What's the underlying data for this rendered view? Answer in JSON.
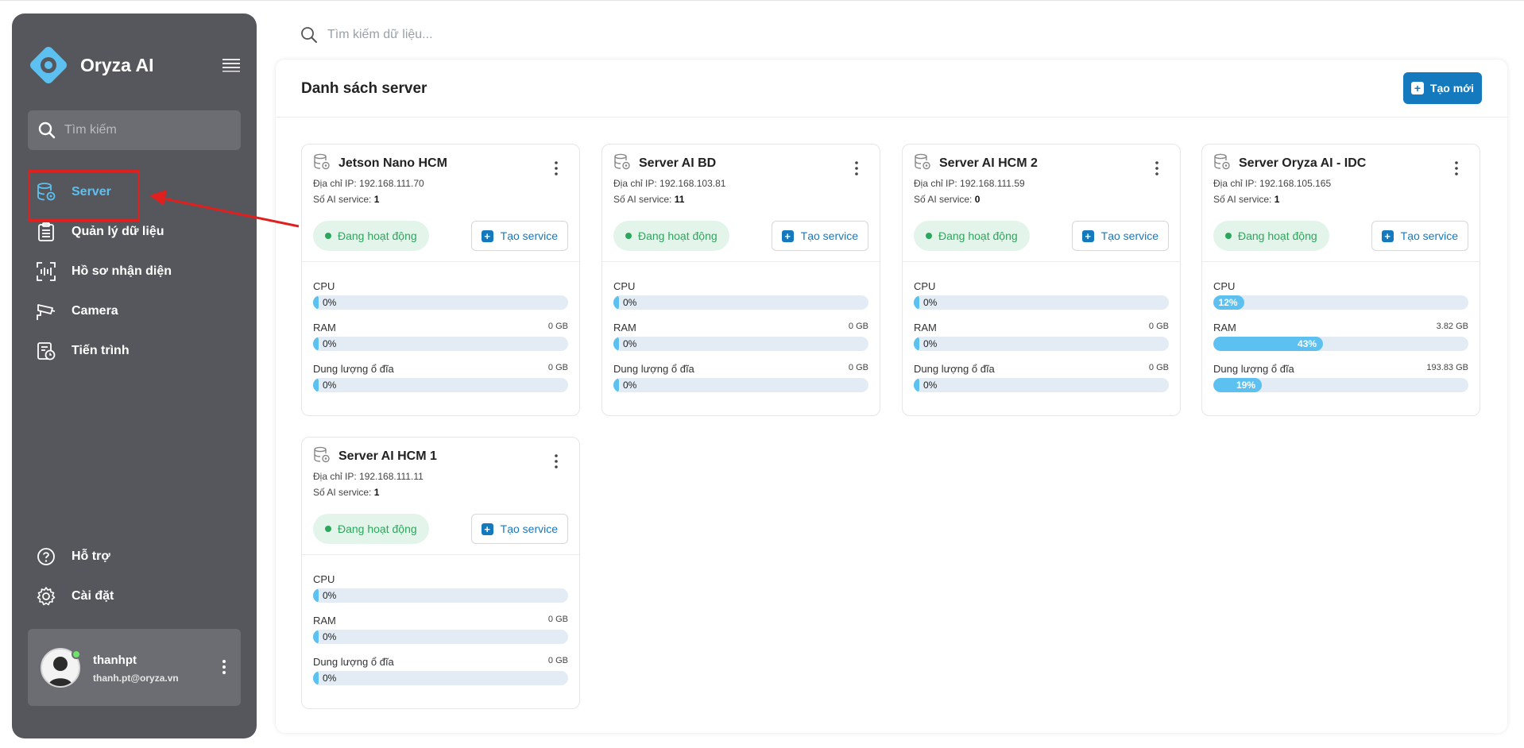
{
  "app": {
    "name": "Oryza AI"
  },
  "sidebar": {
    "search_placeholder": "Tìm kiếm",
    "items": [
      {
        "label": "Server",
        "active": true
      },
      {
        "label": "Quản lý dữ liệu"
      },
      {
        "label": "Hồ sơ nhận diện"
      },
      {
        "label": "Camera"
      },
      {
        "label": "Tiến trình"
      }
    ],
    "bottom_items": [
      {
        "label": "Hỗ trợ"
      },
      {
        "label": "Cài đặt"
      }
    ],
    "user": {
      "name": "thanhpt",
      "email": "thanh.pt@oryza.vn"
    }
  },
  "top_search": {
    "placeholder": "Tìm kiếm dữ liệu..."
  },
  "main": {
    "title": "Danh sách server",
    "create_label": "Tạo mới"
  },
  "labels": {
    "ip_prefix": "Địa chỉ IP:",
    "count_prefix": "Số AI service:",
    "status": "Đang hoạt động",
    "create_service": "Tạo service",
    "cpu": "CPU",
    "ram": "RAM",
    "disk": "Dung lượng ổ đĩa"
  },
  "servers": [
    {
      "name": "Jetson Nano HCM",
      "ip": "192.168.111.70",
      "ai_services": "1",
      "cpu_pct": 0,
      "cpu_text": "0%",
      "ram_pct": 0,
      "ram_text": "0%",
      "ram_total": "0 GB",
      "disk_pct": 0,
      "disk_text": "0%",
      "disk_total": "0 GB"
    },
    {
      "name": "Server AI BD",
      "ip": "192.168.103.81",
      "ai_services": "11",
      "cpu_pct": 0,
      "cpu_text": "0%",
      "ram_pct": 0,
      "ram_text": "0%",
      "ram_total": "0 GB",
      "disk_pct": 0,
      "disk_text": "0%",
      "disk_total": "0 GB"
    },
    {
      "name": "Server AI HCM 2",
      "ip": "192.168.111.59",
      "ai_services": "0",
      "cpu_pct": 0,
      "cpu_text": "0%",
      "ram_pct": 0,
      "ram_text": "0%",
      "ram_total": "0 GB",
      "disk_pct": 0,
      "disk_text": "0%",
      "disk_total": "0 GB"
    },
    {
      "name": "Server Oryza AI - IDC",
      "ip": "192.168.105.165",
      "ai_services": "1",
      "cpu_pct": 12,
      "cpu_text": "12%",
      "ram_pct": 43,
      "ram_text": "43%",
      "ram_total": "3.82 GB",
      "disk_pct": 19,
      "disk_text": "19%",
      "disk_total": "193.83 GB"
    },
    {
      "name": "Server AI HCM 1",
      "ip": "192.168.111.11",
      "ai_services": "1",
      "cpu_pct": 0,
      "cpu_text": "0%",
      "ram_pct": 0,
      "ram_text": "0%",
      "ram_total": "0 GB",
      "disk_pct": 0,
      "disk_text": "0%",
      "disk_total": "0 GB"
    }
  ],
  "colors": {
    "accent": "#1579be",
    "active": "#5cc1f0",
    "status_green": "#2aa75c",
    "sidebar_bg": "#55575c",
    "highlight": "#e0201f"
  },
  "icons": [
    "diamond-logo-icon",
    "menu-icon",
    "search-icon",
    "server-icon",
    "clipboard-list-icon",
    "face-scan-icon",
    "cctv-camera-icon",
    "task-clock-icon",
    "help-icon",
    "gear-icon",
    "kebab-icon",
    "plus-square-icon",
    "arrow-annotation"
  ]
}
